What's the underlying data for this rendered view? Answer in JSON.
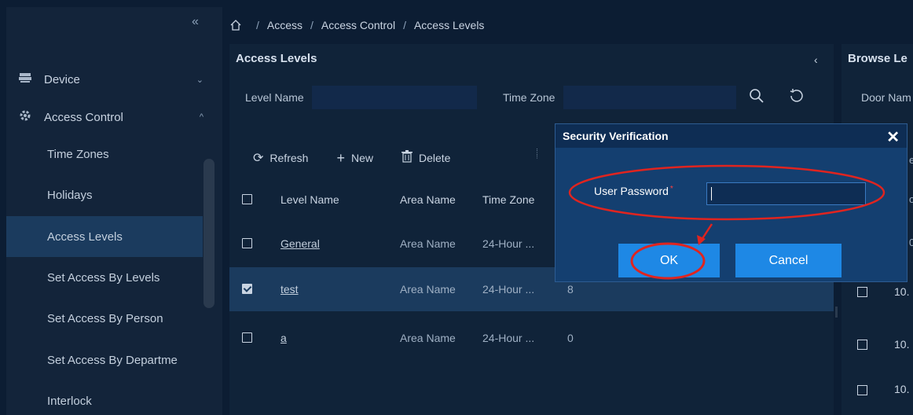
{
  "sidebar": {
    "collapse_glyph": "«",
    "groups": [
      {
        "label": "Device",
        "icon": "device-icon",
        "chevron": "⌄"
      },
      {
        "label": "Access Control",
        "icon": "gear-icon",
        "chevron": "^"
      }
    ],
    "items": [
      {
        "label": "Time Zones"
      },
      {
        "label": "Holidays"
      },
      {
        "label": "Access Levels",
        "active": true
      },
      {
        "label": "Set Access By Levels"
      },
      {
        "label": "Set Access By Person"
      },
      {
        "label": "Set Access By Departme"
      },
      {
        "label": "Interlock"
      }
    ]
  },
  "breadcrumb": {
    "sep": "/",
    "items": [
      "Access",
      "Access Control",
      "Access Levels"
    ]
  },
  "main": {
    "title": "Access Levels",
    "collapse_glyph": "‹",
    "filters": {
      "level_name_label": "Level Name",
      "time_zone_label": "Time Zone"
    },
    "toolbar": {
      "refresh": "Refresh",
      "new": "New",
      "delete": "Delete"
    },
    "table": {
      "headers": {
        "level_name": "Level Name",
        "area_name": "Area Name",
        "time_zone": "Time Zone"
      },
      "rows": [
        {
          "level_name": "General",
          "area_name": "Area Name",
          "time_zone": "24-Hour ...",
          "count": "",
          "checked": false
        },
        {
          "level_name": "test",
          "area_name": "Area Name",
          "time_zone": "24-Hour ...",
          "count": "8",
          "checked": true
        },
        {
          "level_name": "a",
          "area_name": "Area Name",
          "time_zone": "24-Hour ...",
          "count": "0",
          "checked": false
        }
      ]
    }
  },
  "right_panel": {
    "title": "Browse Le",
    "filter_label": "Door Nam",
    "edge_chars": [
      "e",
      "o",
      "0."
    ],
    "values": [
      "10.",
      "10.",
      "10."
    ]
  },
  "dialog": {
    "title": "Security Verification",
    "close_glyph": "✕",
    "password_label": "User Password",
    "required_mark": "*",
    "password_value": "",
    "ok_label": "OK",
    "cancel_label": "Cancel"
  },
  "colors": {
    "accent": "#1e88e5",
    "annotation": "#e0241f",
    "active_row": "#1b3b5e"
  }
}
